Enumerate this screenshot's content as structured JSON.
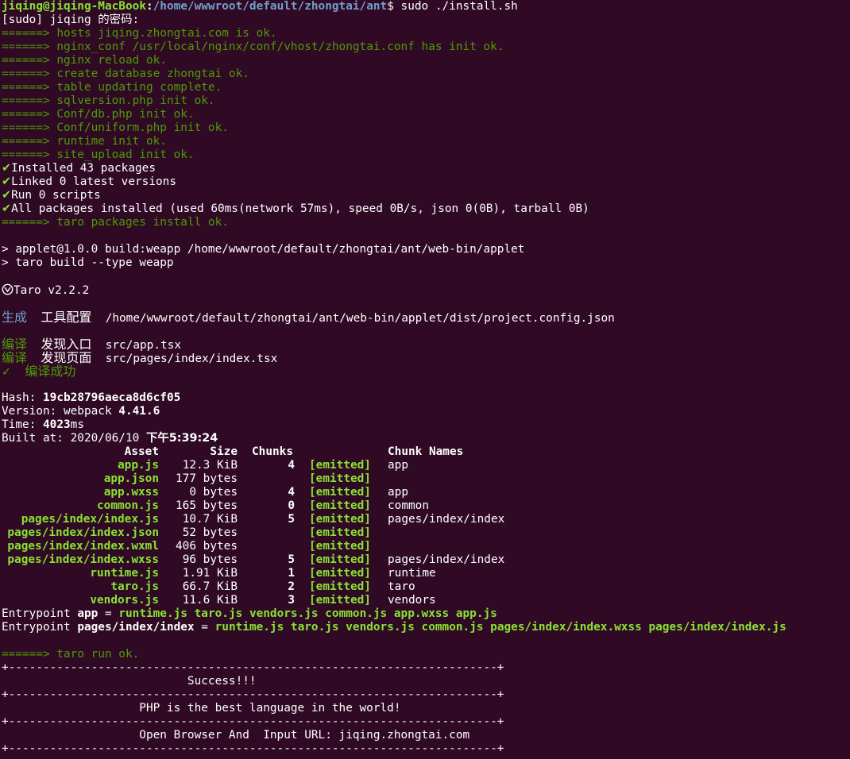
{
  "prompt": {
    "user_host": "jiqing@jiqing-MacBook",
    "path": "/home/wwwroot/default/zhongtai/ant",
    "command": "sudo ./install.sh"
  },
  "sudo_prompt": "[sudo] jiqing 的密码:",
  "install_steps": [
    {
      "arrow": "======>",
      "text": "hosts jiqing.zhongtai.com is ok."
    },
    {
      "arrow": "======>",
      "text": "nginx_conf /usr/local/nginx/conf/vhost/zhongtai.conf has init ok."
    },
    {
      "arrow": "======>",
      "text": "nginx reload ok."
    },
    {
      "arrow": "======>",
      "text": "create database zhongtai ok."
    },
    {
      "arrow": "======>",
      "text": "table updating complete."
    },
    {
      "arrow": "======>",
      "text": "sqlversion.php init ok."
    },
    {
      "arrow": "======>",
      "text": "Conf/db.php init ok."
    },
    {
      "arrow": "======>",
      "text": "Conf/uniform.php init ok."
    },
    {
      "arrow": "======>",
      "text": "runtime init ok."
    },
    {
      "arrow": "======>",
      "text": "site_upload init ok."
    }
  ],
  "npm": [
    {
      "check": "✔",
      "text": "Installed 43 packages"
    },
    {
      "check": "✔",
      "text": "Linked 0 latest versions"
    },
    {
      "check": "✔",
      "text": "Run 0 scripts"
    },
    {
      "check": "✔",
      "text": "All packages installed (used 60ms(network 57ms), speed 0B/s, json 0(0B), tarball 0B)"
    }
  ],
  "taro_install": {
    "arrow": "======>",
    "text": "taro packages install ok."
  },
  "build_cmds": [
    "> applet@1.0.0 build:weapp /home/wwwroot/default/zhongtai/ant/web-bin/applet",
    "> taro build --type weapp"
  ],
  "taro_version": "Taro v2.2.2",
  "generate": {
    "tag": "生成",
    "label": "工具配置",
    "path": "/home/wwwroot/default/zhongtai/ant/web-bin/applet/dist/project.config.json"
  },
  "compile": [
    {
      "tag": "编译",
      "label": "发现入口",
      "path": "src/app.tsx"
    },
    {
      "tag": "编译",
      "label": "发现页面",
      "path": "src/pages/index/index.tsx"
    }
  ],
  "compile_ok": {
    "mark": "✓",
    "text": "编译成功"
  },
  "webpack": {
    "hash_label": "Hash:",
    "hash": "19cb28796aeca8d6cf05",
    "version_label": "Version: webpack",
    "version": "4.41.6",
    "time_label": "Time:",
    "time": "4023",
    "time_unit": "ms",
    "built_label": "Built at: 2020/06/10",
    "built_time": "下午5:39:24"
  },
  "assets_header": {
    "asset": "Asset",
    "size": "Size",
    "chunks": "Chunks",
    "names": "Chunk Names"
  },
  "assets": [
    {
      "asset": "app.js",
      "size": "12.3 KiB",
      "chunks": "4",
      "status": "[emitted]",
      "names": "app"
    },
    {
      "asset": "app.json",
      "size": "177 bytes",
      "chunks": "",
      "status": "[emitted]",
      "names": ""
    },
    {
      "asset": "app.wxss",
      "size": "0 bytes",
      "chunks": "4",
      "status": "[emitted]",
      "names": "app"
    },
    {
      "asset": "common.js",
      "size": "165 bytes",
      "chunks": "0",
      "status": "[emitted]",
      "names": "common"
    },
    {
      "asset": "pages/index/index.js",
      "size": "10.7 KiB",
      "chunks": "5",
      "status": "[emitted]",
      "names": "pages/index/index"
    },
    {
      "asset": "pages/index/index.json",
      "size": "52 bytes",
      "chunks": "",
      "status": "[emitted]",
      "names": ""
    },
    {
      "asset": "pages/index/index.wxml",
      "size": "406 bytes",
      "chunks": "",
      "status": "[emitted]",
      "names": ""
    },
    {
      "asset": "pages/index/index.wxss",
      "size": "96 bytes",
      "chunks": "5",
      "status": "[emitted]",
      "names": "pages/index/index"
    },
    {
      "asset": "runtime.js",
      "size": "1.91 KiB",
      "chunks": "1",
      "status": "[emitted]",
      "names": "runtime"
    },
    {
      "asset": "taro.js",
      "size": "66.7 KiB",
      "chunks": "2",
      "status": "[emitted]",
      "names": "taro"
    },
    {
      "asset": "vendors.js",
      "size": "11.6 KiB",
      "chunks": "3",
      "status": "[emitted]",
      "names": "vendors"
    }
  ],
  "entrypoints": [
    {
      "label": "Entrypoint",
      "name": "app",
      "eq": "=",
      "files": "runtime.js taro.js vendors.js common.js app.wxss app.js"
    },
    {
      "label": "Entrypoint",
      "name": "pages/index/index",
      "eq": "=",
      "files": "runtime.js taro.js vendors.js common.js pages/index/index.wxss pages/index/index.js"
    }
  ],
  "taro_run": {
    "arrow": "======>",
    "text": "taro run ok."
  },
  "box": {
    "border": "+-----------------------------------------------------------------------+",
    "line1": "                           Success!!!",
    "line2": "                    PHP is the best language in the world!",
    "line3": "                    Open Browser And  Input URL: jiqing.zhongtai.com"
  },
  "colors": {
    "background": "#300a24",
    "green": "#4e9a06",
    "light_green": "#8ae234",
    "blue": "#729fcf"
  }
}
